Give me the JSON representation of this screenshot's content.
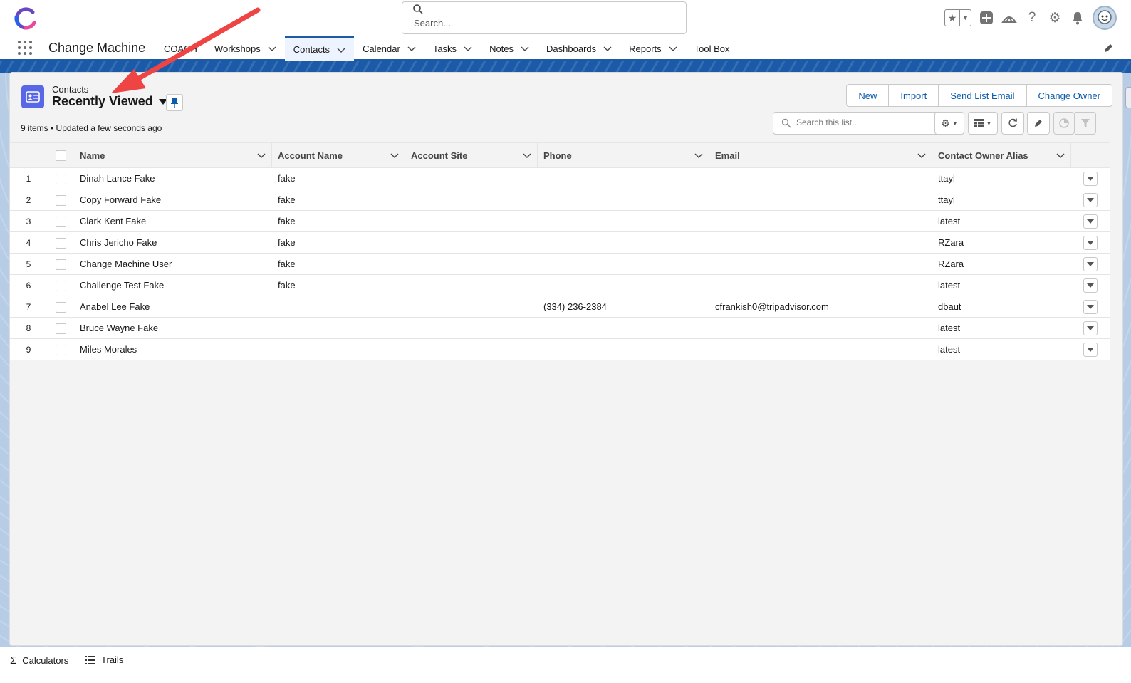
{
  "header": {
    "search_placeholder": "Search...",
    "icons": [
      "favorites-star-icon",
      "favorites-dropdown-icon",
      "global-actions-icon",
      "trailhead-icon",
      "help-icon",
      "setup-gear-icon",
      "notifications-bell-icon",
      "user-avatar"
    ]
  },
  "nav": {
    "app_name": "Change Machine",
    "items": [
      {
        "label": "COACH",
        "has_menu": false
      },
      {
        "label": "Workshops",
        "has_menu": true
      },
      {
        "label": "Contacts",
        "has_menu": true,
        "active": true
      },
      {
        "label": "Calendar",
        "has_menu": true
      },
      {
        "label": "Tasks",
        "has_menu": true
      },
      {
        "label": "Notes",
        "has_menu": true
      },
      {
        "label": "Dashboards",
        "has_menu": true
      },
      {
        "label": "Reports",
        "has_menu": true
      },
      {
        "label": "Tool Box",
        "has_menu": false
      }
    ]
  },
  "list": {
    "object_label": "Contacts",
    "view_name": "Recently Viewed",
    "meta": "9 items • Updated a few seconds ago",
    "buttons": [
      "New",
      "Import",
      "Send List Email",
      "Change Owner"
    ],
    "search_placeholder": "Search this list..."
  },
  "table": {
    "columns": [
      "Name",
      "Account Name",
      "Account Site",
      "Phone",
      "Email",
      "Contact Owner Alias"
    ],
    "rows": [
      {
        "num": "1",
        "name": "Dinah Lance Fake",
        "account": "fake",
        "site": "",
        "phone": "",
        "email": "",
        "owner": "ttayl"
      },
      {
        "num": "2",
        "name": "Copy Forward Fake",
        "account": "fake",
        "site": "",
        "phone": "",
        "email": "",
        "owner": "ttayl"
      },
      {
        "num": "3",
        "name": "Clark Kent Fake",
        "account": "fake",
        "site": "",
        "phone": "",
        "email": "",
        "owner": "latest"
      },
      {
        "num": "4",
        "name": "Chris Jericho Fake",
        "account": "fake",
        "site": "",
        "phone": "",
        "email": "",
        "owner": "RZara"
      },
      {
        "num": "5",
        "name": "Change Machine User",
        "account": "fake",
        "site": "",
        "phone": "",
        "email": "",
        "owner": "RZara"
      },
      {
        "num": "6",
        "name": "Challenge Test Fake",
        "account": "fake",
        "site": "",
        "phone": "",
        "email": "",
        "owner": "latest"
      },
      {
        "num": "7",
        "name": "Anabel Lee Fake",
        "account": "",
        "site": "",
        "phone": "(334) 236-2384",
        "email": "cfrankish0@tripadvisor.com",
        "owner": "dbaut"
      },
      {
        "num": "8",
        "name": "Bruce Wayne Fake",
        "account": "",
        "site": "",
        "phone": "",
        "email": "",
        "owner": "latest"
      },
      {
        "num": "9",
        "name": "Miles Morales",
        "account": "",
        "site": "",
        "phone": "",
        "email": "",
        "owner": "latest"
      }
    ]
  },
  "footer": {
    "items": [
      {
        "label": "Calculators",
        "icon": "sigma-icon"
      },
      {
        "label": "Trails",
        "icon": "list-icon"
      }
    ]
  },
  "colors": {
    "brand_blue": "#1b5aa6",
    "link_blue": "#0b5cab",
    "object_icon": "#5867e8",
    "annotation_arrow": "#ef4444"
  }
}
